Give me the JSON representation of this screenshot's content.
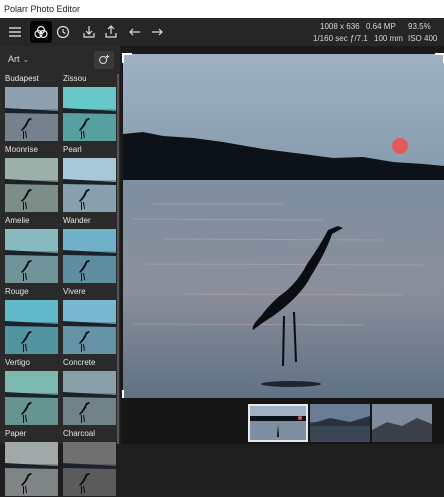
{
  "app": {
    "title": "Polarr Photo Editor"
  },
  "toolbar": {
    "buttons": [
      {
        "icon": "menu-icon"
      },
      {
        "icon": "filters-icon",
        "active": true
      },
      {
        "icon": "history-icon"
      },
      {
        "icon": "import-icon"
      },
      {
        "icon": "export-icon"
      },
      {
        "icon": "undo-icon"
      },
      {
        "icon": "redo-icon"
      }
    ]
  },
  "image_info": {
    "dimensions": "1008 x 636",
    "megapixels": "0.64 MP",
    "zoom": "93.5%",
    "shutter": "1/160 sec",
    "aperture": "ƒ/7.1",
    "focal": "100 mm",
    "iso": "ISO 400"
  },
  "sidebar": {
    "category": "Art",
    "filters": [
      {
        "name": "Budapest",
        "tint": "#8fa0b0"
      },
      {
        "name": "Zissou",
        "tint": "#66c8c8"
      },
      {
        "name": "Moonrise",
        "tint": "#9ab0a8"
      },
      {
        "name": "Pearl",
        "tint": "#a8c8d8"
      },
      {
        "name": "Amelie",
        "tint": "#88b8c0"
      },
      {
        "name": "Wander",
        "tint": "#70b0c8"
      },
      {
        "name": "Rouge",
        "tint": "#60b8c8"
      },
      {
        "name": "Vivere",
        "tint": "#78b8d0"
      },
      {
        "name": "Vertigo",
        "tint": "#7ab8b0"
      },
      {
        "name": "Concrete",
        "tint": "#8aa0a8"
      },
      {
        "name": "Paper",
        "tint": "#a0a8a8"
      },
      {
        "name": "Charcoal",
        "tint": "#707070"
      }
    ]
  },
  "colors": {
    "accent": "#ffffff",
    "sun": "#e25a5a",
    "sky": "#8ea4b6",
    "water": "#6f8191"
  }
}
